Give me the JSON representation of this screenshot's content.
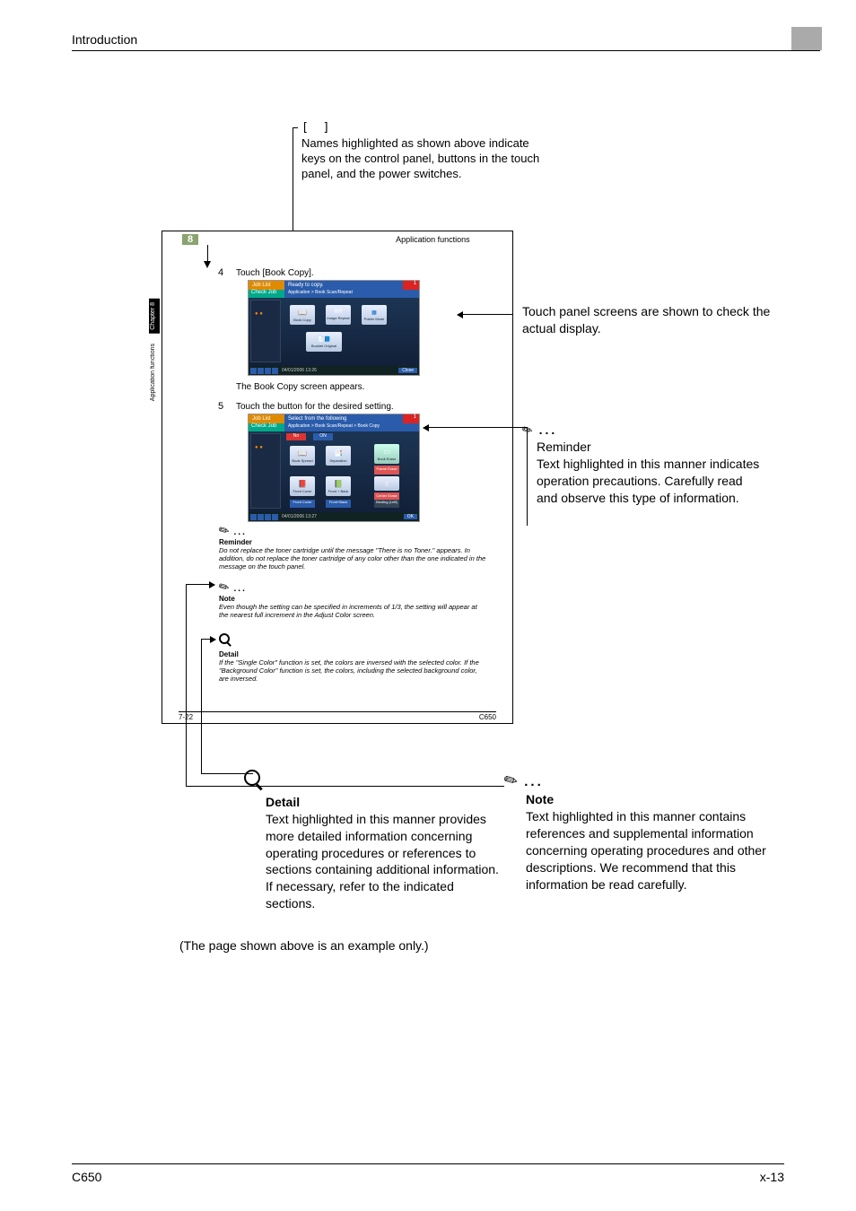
{
  "header": "Introduction",
  "footer_left": "C650",
  "footer_right": "x-13",
  "callout_brackets_sym": "[  ]",
  "callout_brackets_text": "Names highlighted as shown above indicate keys on the control panel, buttons in the touch panel, and the power switches.",
  "manual_page": {
    "chapter_num": "8",
    "section_title": "Application functions",
    "side_chapter": "Chapter 8",
    "side_function": "Application functions",
    "step4_num": "4",
    "step4_text": "Touch [Book Copy].",
    "shot1": {
      "joblist": "Job List",
      "ready": "Ready to copy.",
      "one": "1",
      "checkjob": "Check Job",
      "crumb": "Application > Book Scan/Repeat",
      "btn_bookcopy": "Book Copy",
      "btn_imagerepeat": "Image Repeat",
      "btn_postermode": "Poster Mode",
      "btn_bookletoriginal": "Booklet Original",
      "footer_date": "04/01/2006  13:26",
      "close": "Close"
    },
    "step4_result": "The Book Copy screen appears.",
    "step5_num": "5",
    "step5_text": "Touch the button for the desired setting.",
    "shot2": {
      "joblist": "Job List",
      "ready": "Select from the following",
      "one": "1",
      "checkjob": "Check Job",
      "crumb": "Application > Book Scan/Repeat > Book Copy",
      "btn_no": "No",
      "btn_on": "ON",
      "btn_bookspread": "Book Spread",
      "btn_separation": "Separation",
      "btn_bookerase": "Book Erase",
      "btn_frameerase": "Frame Erase",
      "btn_centererase": "Center Erase",
      "btn_frontcover": "Front Cover",
      "btn_frontback": "Front + Back",
      "btn_binding": "Binding (Left)",
      "footer_date": "04/01/2006  13:27",
      "close": "OK"
    },
    "reminder_title": "Reminder",
    "reminder_text": "Do not replace the toner cartridge until the message \"There is no Toner.\" appears. In addition, do not replace the toner cartridge of any color other than the one indicated in the message on the touch panel.",
    "note_title": "Note",
    "note_text": "Even though the setting can be specified in increments of 1/3, the setting will appear at the nearest full increment in the Adjust Color screen.",
    "detail_title": "Detail",
    "detail_text": "If the \"Single Color\" function is set, the colors are inversed with the selected color. If the \"Background Color\" function is set, the colors, including the selected background color, are inversed.",
    "foot_left": "7-22",
    "foot_right": "C650"
  },
  "callout_touchscreen": "Touch panel screens are shown to check the actual display.",
  "callout_reminder_hd": "Reminder",
  "callout_reminder_txt": "Text highlighted in this manner indicates operation precautions. Carefully read and observe this type of information.",
  "callout_note_hd": "Note",
  "callout_note_txt": "Text highlighted in this manner contains references and supplemental information concerning operating procedures and other descriptions. We recommend that this information be read carefully.",
  "callout_detail_hd": "Detail",
  "callout_detail_txt": "Text highlighted in this manner provides more detailed information concerning operating procedures or references to sections containing additional information. If necessary, refer to the indicated sections.",
  "example_note": "(The page shown above is an example only.)"
}
